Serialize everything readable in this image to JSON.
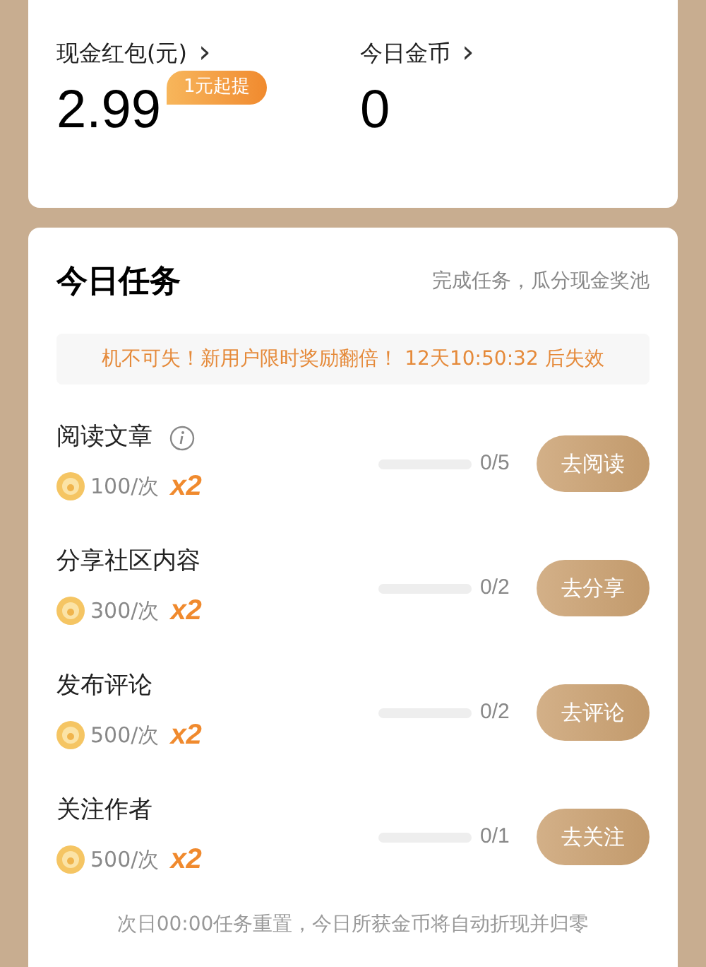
{
  "wallet": [
    {
      "label": "现金红包(元)",
      "chevron": "›",
      "value": "2.99",
      "badge": "1元起提"
    },
    {
      "label": "今日金币",
      "chevron": "›",
      "value": "0"
    }
  ],
  "tasks_panel": {
    "title": "今日任务",
    "subtitle": "完成任务，瓜分现金奖池",
    "notice": "机不可失！新用户限时奖励翻倍！ 12天10:50:32 后失效",
    "tasks": [
      {
        "name": "阅读文章",
        "has_info": true,
        "reward": "100/次",
        "multiplier": "x2",
        "progress": "0/5",
        "action": "去阅读"
      },
      {
        "name": "分享社区内容",
        "has_info": false,
        "reward": "300/次",
        "multiplier": "x2",
        "progress": "0/2",
        "action": "去分享"
      },
      {
        "name": "发布评论",
        "has_info": false,
        "reward": "500/次",
        "multiplier": "x2",
        "progress": "0/2",
        "action": "去评论"
      },
      {
        "name": "关注作者",
        "has_info": false,
        "reward": "500/次",
        "multiplier": "x2",
        "progress": "0/1",
        "action": "去关注"
      }
    ],
    "footer": "次日00:00任务重置，今日所获金币将自动折现并归零"
  }
}
